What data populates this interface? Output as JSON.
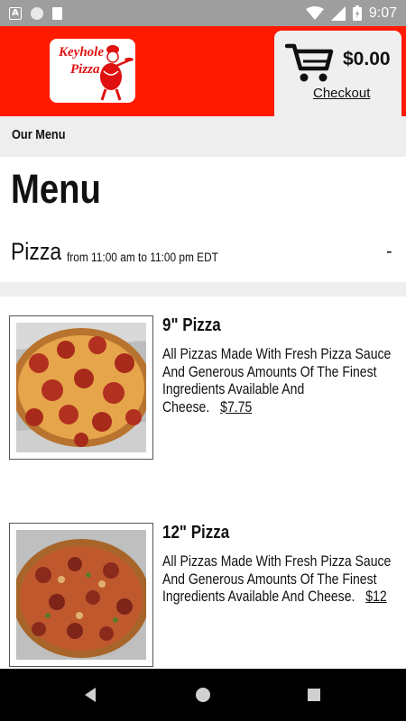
{
  "status_bar": {
    "time": "9:07",
    "icons": [
      "a-notification-icon",
      "circle-notification-icon",
      "sd-card-icon",
      "wifi-icon",
      "signal-icon",
      "battery-icon"
    ]
  },
  "header": {
    "logo_alt": "Keyhole Pizza",
    "logo_text_line1": "Keyhole",
    "logo_text_line2": "Pizza",
    "cart_total": "$0.00",
    "checkout_label": "Checkout",
    "colors": {
      "brand_red": "#ff1a00",
      "panel_gray": "#efefef"
    }
  },
  "breadcrumb": {
    "label": "Our Menu"
  },
  "page": {
    "title": "Menu"
  },
  "category": {
    "name": "Pizza",
    "hours": "from 11:00 am to 11:00 pm EDT",
    "toggle": "-"
  },
  "items": [
    {
      "name": "9\" Pizza",
      "description": "All Pizzas Made With Fresh Pizza Sauce And Generous Amounts Of The Finest Ingredients Available And Cheese.",
      "price": "$7.75"
    },
    {
      "name": "12\" Pizza",
      "description": "All Pizzas Made With Fresh Pizza Sauce And Generous Amounts Of The Finest Ingredients Available And Cheese.",
      "price": "$12"
    }
  ],
  "nav": {
    "icons": [
      "back-icon",
      "home-icon",
      "recent-apps-icon"
    ]
  }
}
